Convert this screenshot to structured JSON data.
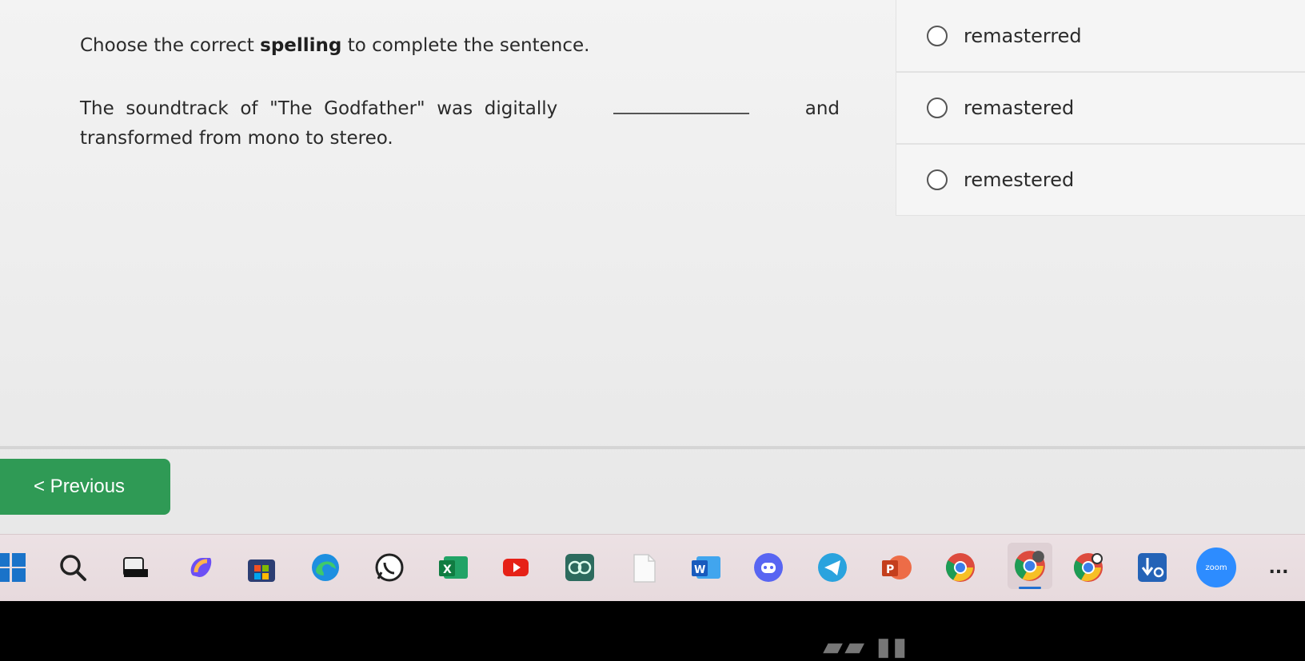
{
  "question": {
    "prompt_pre": "Choose the correct ",
    "prompt_bold": "spelling",
    "prompt_post": " to complete the sentence.",
    "sentence_part1": "The  soundtrack  of  \"The  Godfather\"  was  digitally",
    "sentence_part2": "and",
    "sentence_part3": "transformed from mono to stereo."
  },
  "options": [
    {
      "label": "remasterred",
      "selected": false
    },
    {
      "label": "remastered",
      "selected": false
    },
    {
      "label": "remestered",
      "selected": false
    }
  ],
  "navigation": {
    "previous_label": "< Previous"
  },
  "taskbar": {
    "icons": [
      "start-icon",
      "search-icon",
      "task-view-icon",
      "copilot-icon",
      "store-icon",
      "edge-icon",
      "whatsapp-icon",
      "excel-icon",
      "youtube-icon",
      "brain-app-icon",
      "file-icon",
      "word-icon",
      "discord-icon",
      "telegram-icon",
      "powerpoint-icon",
      "chrome-icon",
      "chrome-active-icon",
      "chrome-beta-icon",
      "download-app-icon",
      "zoom-icon",
      "more-icon"
    ],
    "zoom_label": "zoom",
    "more_label": "..."
  },
  "colors": {
    "accent_green": "#2f9a55",
    "taskbar_bg": "#ece1e4"
  }
}
